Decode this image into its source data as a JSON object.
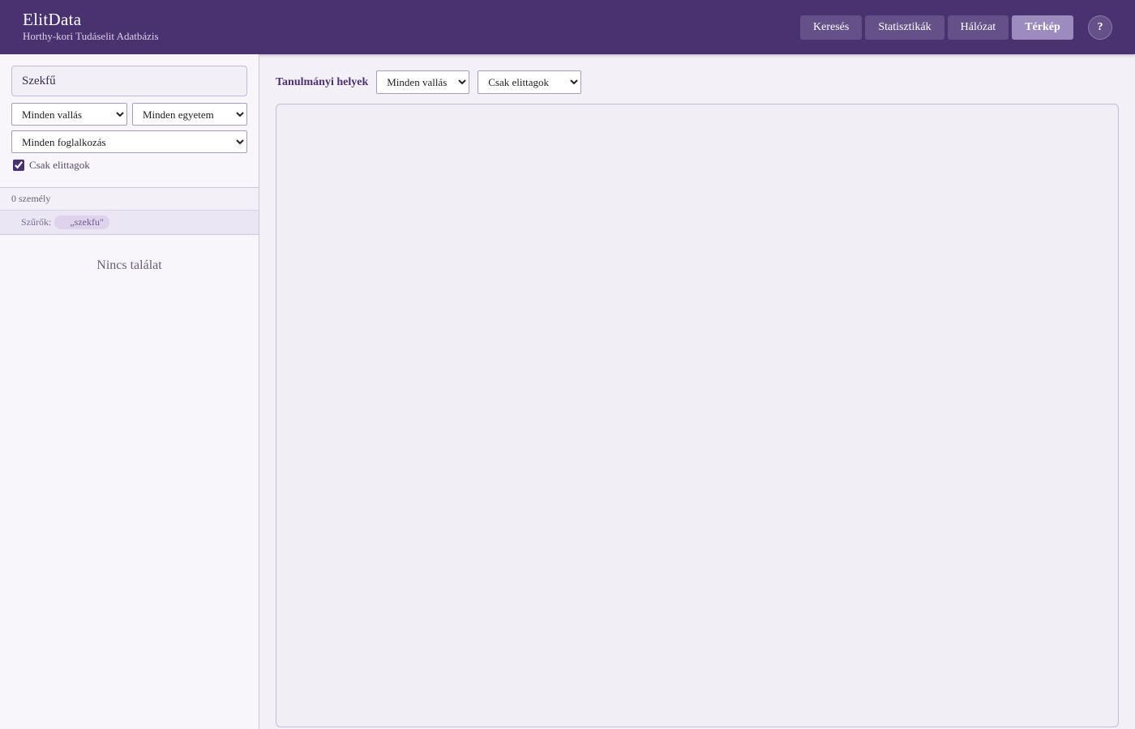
{
  "header": {
    "title": "ElitData",
    "subtitle": "Horthy-kori Tudáselit Adatbázis",
    "nav": [
      "Keresés",
      "Statisztikák",
      "Hálózat",
      "Térkép"
    ],
    "active_nav": "Térkép",
    "help_label": "?"
  },
  "sidebar": {
    "search_value": "Szekfű",
    "religion_select": "Minden vallás",
    "university_select": "Minden egyetem",
    "occupation_select": "Minden foglalkozás",
    "elite_only_label": "Csak elittagok",
    "elite_only_checked": true,
    "result_count": "0 személy",
    "filters_label": "Szűrők:",
    "filter_chip": "„szekfu\"",
    "no_result": "Nincs találat"
  },
  "main": {
    "toolbar_label": "Tanulmányi helyek",
    "religion_select": "Minden vallás",
    "elite_select": "Csak elittagok"
  },
  "colors": {
    "header_bg": "#4a3170",
    "nav_button": "#65508a",
    "nav_active": "#9c8cbd",
    "page_bg": "#f3f0f7"
  }
}
